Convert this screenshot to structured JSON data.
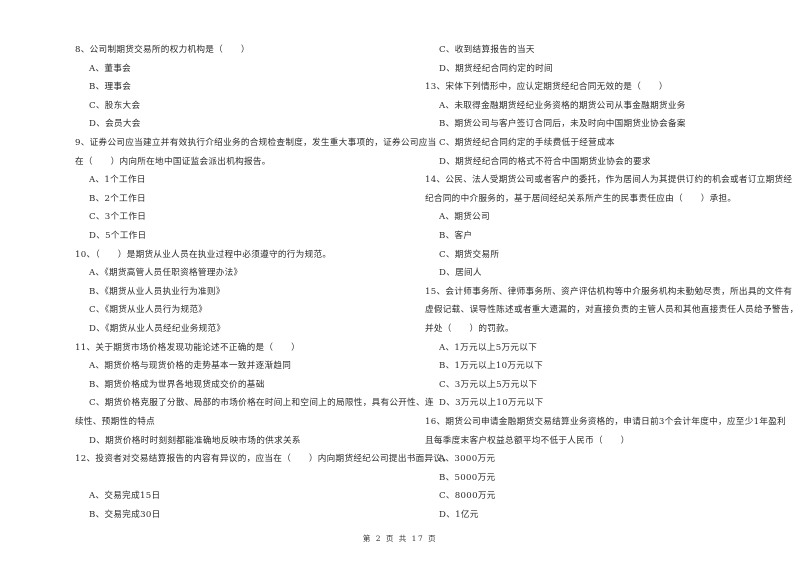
{
  "left_column": [
    {
      "type": "q",
      "text": "8、公司制期货交易所的权力机构是（　　）"
    },
    {
      "type": "opt",
      "text": "A、董事会"
    },
    {
      "type": "opt",
      "text": "B、理事会"
    },
    {
      "type": "opt",
      "text": "C、股东大会"
    },
    {
      "type": "opt",
      "text": "D、会员大会"
    },
    {
      "type": "q",
      "text": "9、证券公司应当建立并有效执行介绍业务的合规检查制度，发生重大事项的，证券公司应当"
    },
    {
      "type": "q",
      "text": "在（　　）内向所在地中国证监会派出机构报告。"
    },
    {
      "type": "opt",
      "text": "A、1个工作日"
    },
    {
      "type": "opt",
      "text": "B、2个工作日"
    },
    {
      "type": "opt",
      "text": "C、3个工作日"
    },
    {
      "type": "opt",
      "text": "D、5个工作日"
    },
    {
      "type": "q",
      "text": "10、（　　）是期货从业人员在执业过程中必须遵守的行为规范。"
    },
    {
      "type": "opt",
      "text": "A、《期货高管人员任职资格管理办法》"
    },
    {
      "type": "opt",
      "text": "B、《期货从业人员执业行为准则》"
    },
    {
      "type": "opt",
      "text": "C、《期货从业人员行为规范》"
    },
    {
      "type": "opt",
      "text": "D、《期货从业人员经纪业务规范》"
    },
    {
      "type": "q",
      "text": "11、关于期货市场价格发现功能论述不正确的是（　　）"
    },
    {
      "type": "opt",
      "text": "A、期货价格与现货价格的走势基本一致并逐渐趋同"
    },
    {
      "type": "opt",
      "text": "B、期货价格成为世界各地现货成交价的基础"
    },
    {
      "type": "opt",
      "text": "C、期货价格克服了分散、局部的市场价格在时间上和空间上的局限性，具有公开性、连"
    },
    {
      "type": "q",
      "text": "续性、预期性的特点"
    },
    {
      "type": "opt",
      "text": "D、期货价格时时刻刻都能准确地反映市场的供求关系"
    },
    {
      "type": "q",
      "text": "12、投资者对交易结算报告的内容有异议的，应当在（　　）内向期货经纪公司提出书面异议。"
    },
    {
      "type": "blank",
      "text": ""
    },
    {
      "type": "opt",
      "text": "A、交易完成15日"
    },
    {
      "type": "opt",
      "text": "B、交易完成30日"
    }
  ],
  "right_column": [
    {
      "type": "opt",
      "text": "C、收到结算报告的当天"
    },
    {
      "type": "opt",
      "text": "D、期货经纪合同约定的时间"
    },
    {
      "type": "q",
      "text": "13、宋体下列情形中，应认定期货经纪合同无效的是（　　）"
    },
    {
      "type": "opt",
      "text": "A、未取得金融期货经纪业务资格的期货公司从事金融期货业务"
    },
    {
      "type": "opt",
      "text": "B、期货公司与客户签订合同后，未及时向中国期货业协会备案"
    },
    {
      "type": "opt",
      "text": "C、期货经纪合同约定的手续费低于经营成本"
    },
    {
      "type": "opt",
      "text": "D、期货经纪合同的格式不符合中国期货业协会的要求"
    },
    {
      "type": "q",
      "text": "14、公民、法人受期货公司或者客户的委托，作为居间人为其提供订约的机会或者订立期货经"
    },
    {
      "type": "q",
      "text": "纪合同的中介服务的，基于居间经纪关系所产生的民事责任应由（　　）承担。"
    },
    {
      "type": "opt",
      "text": "A、期货公司"
    },
    {
      "type": "opt",
      "text": "B、客户"
    },
    {
      "type": "opt",
      "text": "C、期货交易所"
    },
    {
      "type": "opt",
      "text": "D、居间人"
    },
    {
      "type": "q",
      "text": "15、会计师事务所、律师事务所、资产评估机构等中介服务机构未勤勉尽责，所出具的文件有"
    },
    {
      "type": "q",
      "text": "虚假记载、误导性陈述或者重大遗漏的，对直接负责的主管人员和其他直接责任人员给予警告，"
    },
    {
      "type": "q",
      "text": "并处（　　）的罚款。"
    },
    {
      "type": "opt",
      "text": "A、1万元以上5万元以下"
    },
    {
      "type": "opt",
      "text": "B、1万元以上10万元以下"
    },
    {
      "type": "opt",
      "text": "C、3万元以上5万元以下"
    },
    {
      "type": "opt",
      "text": "D、3万元以上10万元以下"
    },
    {
      "type": "q",
      "text": "16、期货公司申请金融期货交易结算业务资格的，申请日前3个会计年度中，应至少1年盈利"
    },
    {
      "type": "q",
      "text": "且每季度末客户权益总额平均不低于人民币（　　）"
    },
    {
      "type": "opt",
      "text": "A、3000万元"
    },
    {
      "type": "opt",
      "text": "B、5000万元"
    },
    {
      "type": "opt",
      "text": "C、8000万元"
    },
    {
      "type": "opt",
      "text": "D、1亿元"
    }
  ],
  "footer": {
    "page_label": "第 2 页 共 17 页"
  }
}
